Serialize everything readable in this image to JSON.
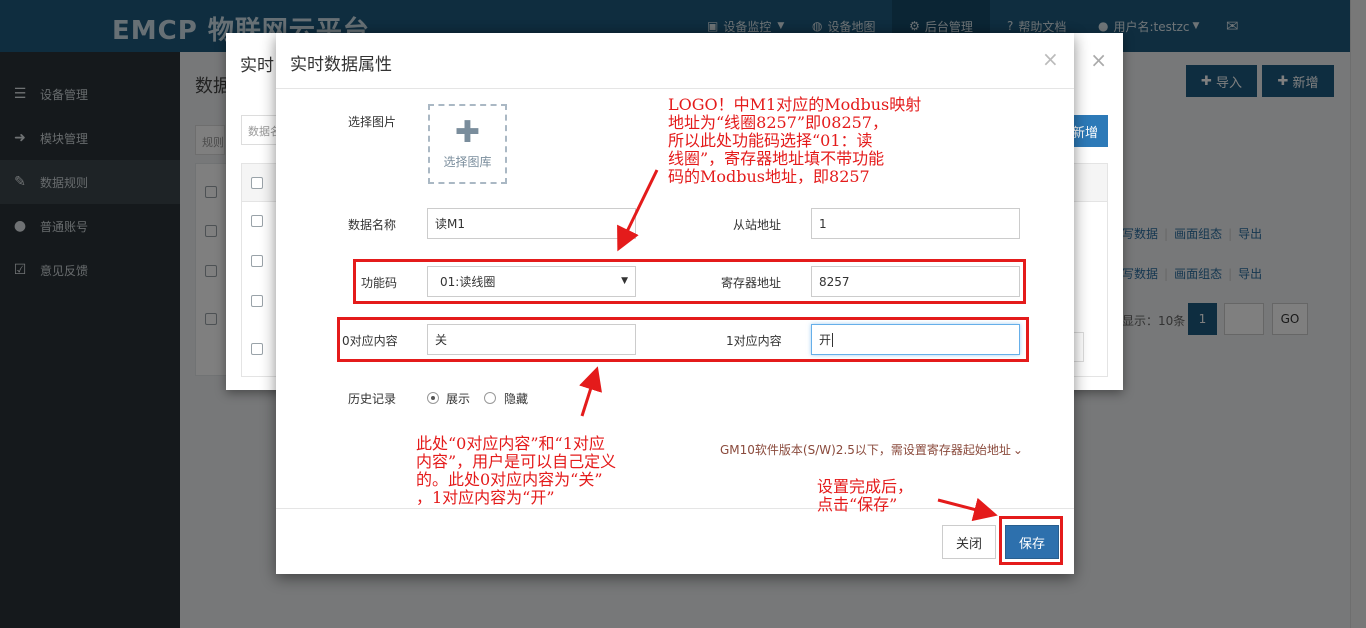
{
  "topbar": {
    "logo": "EMCP 物联网云平台",
    "nav": {
      "monitor": "设备监控",
      "map": "设备地图",
      "admin": "后台管理",
      "help": "帮助文档",
      "user": "用户名:testzc"
    }
  },
  "sidebar": {
    "items": [
      {
        "label": "设备管理",
        "icon": "list-icon"
      },
      {
        "label": "模块管理",
        "icon": "sign-in-icon"
      },
      {
        "label": "数据规则",
        "icon": "pencil-icon"
      },
      {
        "label": "普通账号",
        "icon": "user-icon"
      },
      {
        "label": "意见反馈",
        "icon": "edit-icon"
      }
    ],
    "active_index": 2
  },
  "background": {
    "page_title": "数据",
    "import_label": "导入",
    "add_label": "新增",
    "add2_label": "新增",
    "filter_placeholder": "规则",
    "search_placeholder": "数据名",
    "ops": [
      "写数据",
      "画面组态",
      "导出"
    ],
    "pager_text": "显示：10条",
    "pager_page": "1",
    "go_label": "GO"
  },
  "back_modal": {
    "title": "实时"
  },
  "modal": {
    "title": "实时数据属性",
    "image_label": "选择图片",
    "image_picker": "选择图库",
    "name_label": "数据名称",
    "name_value": "读M1",
    "slave_label": "从站地址",
    "slave_value": "1",
    "func_label": "功能码",
    "func_value": "01:读线圈",
    "reg_label": "寄存器地址",
    "reg_value": "8257",
    "zero_label": "0对应内容",
    "zero_value": "关",
    "one_label": "1对应内容",
    "one_value": "开",
    "history_label": "历史记录",
    "history_options": [
      "展示",
      "隐藏"
    ],
    "history_selected": "展示",
    "gm_note": "GM10软件版本(S/W)2.5以下，需设置寄存器起始地址",
    "close_button": "关闭",
    "save_button": "保存"
  },
  "annotations": {
    "top": [
      "LOGO！中M1对应的Modbus映射",
      "地址为“线圈8257”即08257，",
      "所以此处功能码选择“01：读",
      "线圈”，寄存器地址填不带功能",
      "码的Modbus地址，即8257"
    ],
    "bottom": [
      "此处“0对应内容”和“1对应",
      "内容”，用户是可以自己定义",
      "的。此处0对应内容为“关”",
      "，1对应内容为“开”"
    ],
    "save": [
      "设置完成后，",
      "点击“保存”"
    ]
  },
  "colors": {
    "topbar": "#1e5b7e",
    "sidebar": "#2b3338",
    "annotation_red": "#e41b1b",
    "save_blue": "#2d70ad"
  }
}
